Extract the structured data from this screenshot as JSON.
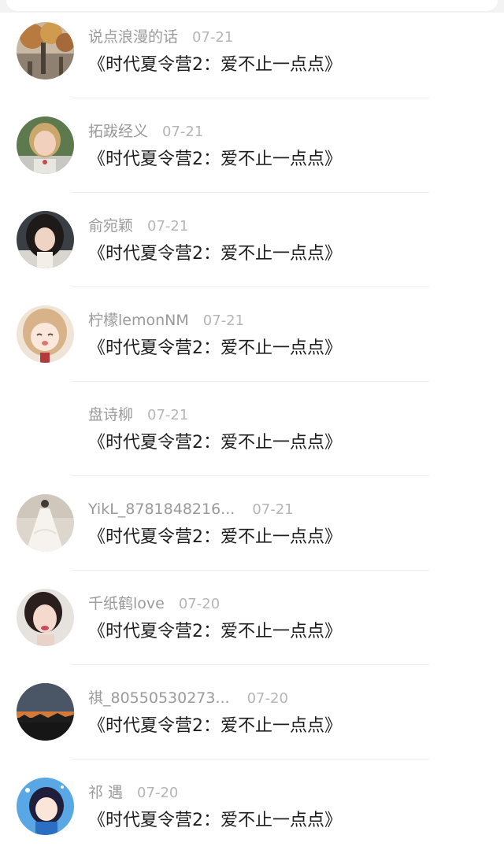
{
  "comments": [
    {
      "user": "说点浪漫的话",
      "date": "07-21",
      "text": "《时代夏令营2：爱不止一点点》",
      "avatar": "autumn-tree-avatar"
    },
    {
      "user": "拓跋经义",
      "date": "07-21",
      "text": "《时代夏令营2：爱不止一点点》",
      "avatar": "blonde-girl-avatar"
    },
    {
      "user": "俞宛颖",
      "date": "07-21",
      "text": "《时代夏令营2：爱不止一点点》",
      "avatar": "dark-hair-girl-avatar"
    },
    {
      "user": "柠檬lemonNM",
      "date": "07-21",
      "text": "《时代夏令营2：爱不止一点点》",
      "avatar": "anime-girl-avatar"
    },
    {
      "user": "盘诗柳",
      "date": "07-21",
      "text": "《时代夏令营2：爱不止一点点》",
      "avatar": "blank-avatar"
    },
    {
      "user": "YikL_8781848216...",
      "date": "07-21",
      "text": "《时代夏令营2：爱不止一点点》",
      "avatar": "wedding-dress-avatar"
    },
    {
      "user": "千纸鹤love",
      "date": "07-20",
      "text": "《时代夏令营2：爱不止一点点》",
      "avatar": "short-hair-woman-avatar"
    },
    {
      "user": "祺_80550530273...",
      "date": "07-20",
      "text": "《时代夏令营2：爱不止一点点》",
      "avatar": "sunset-avatar"
    },
    {
      "user": "祁 遇",
      "date": "07-20",
      "text": "《时代夏令营2：爱不止一点点》",
      "avatar": "cartoon-blue-avatar"
    }
  ]
}
